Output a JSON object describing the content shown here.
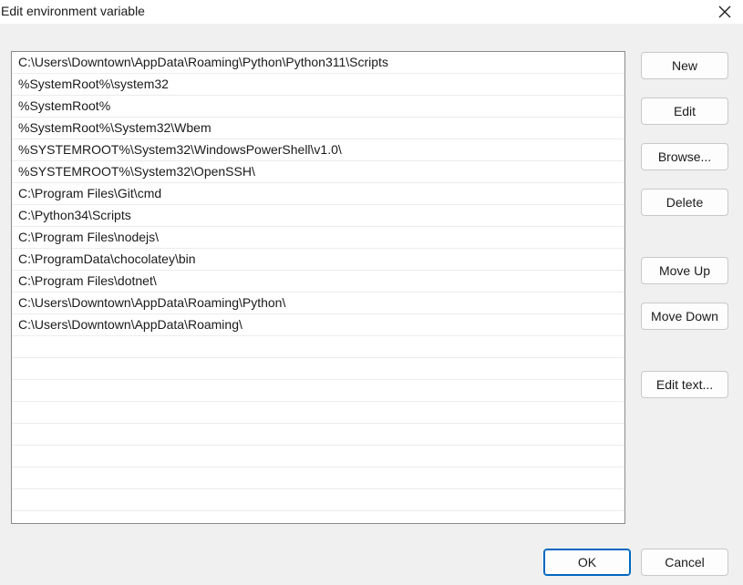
{
  "window": {
    "title": "Edit environment variable",
    "close_icon": "close-icon"
  },
  "entries": [
    "C:\\Users\\Downtown\\AppData\\Roaming\\Python\\Python311\\Scripts",
    "%SystemRoot%\\system32",
    "%SystemRoot%",
    "%SystemRoot%\\System32\\Wbem",
    "%SYSTEMROOT%\\System32\\WindowsPowerShell\\v1.0\\",
    "%SYSTEMROOT%\\System32\\OpenSSH\\",
    "C:\\Program Files\\Git\\cmd",
    "C:\\Python34\\Scripts",
    "C:\\Program Files\\nodejs\\",
    "C:\\ProgramData\\chocolatey\\bin",
    "C:\\Program Files\\dotnet\\",
    "C:\\Users\\Downtown\\AppData\\Roaming\\Python\\",
    "C:\\Users\\Downtown\\AppData\\Roaming\\"
  ],
  "buttons": {
    "new": "New",
    "edit": "Edit",
    "browse": "Browse...",
    "delete": "Delete",
    "move_up": "Move Up",
    "move_down": "Move Down",
    "edit_text": "Edit text...",
    "ok": "OK",
    "cancel": "Cancel"
  },
  "colors": {
    "accent": "#0067c0",
    "background": "#f0f0f0"
  }
}
